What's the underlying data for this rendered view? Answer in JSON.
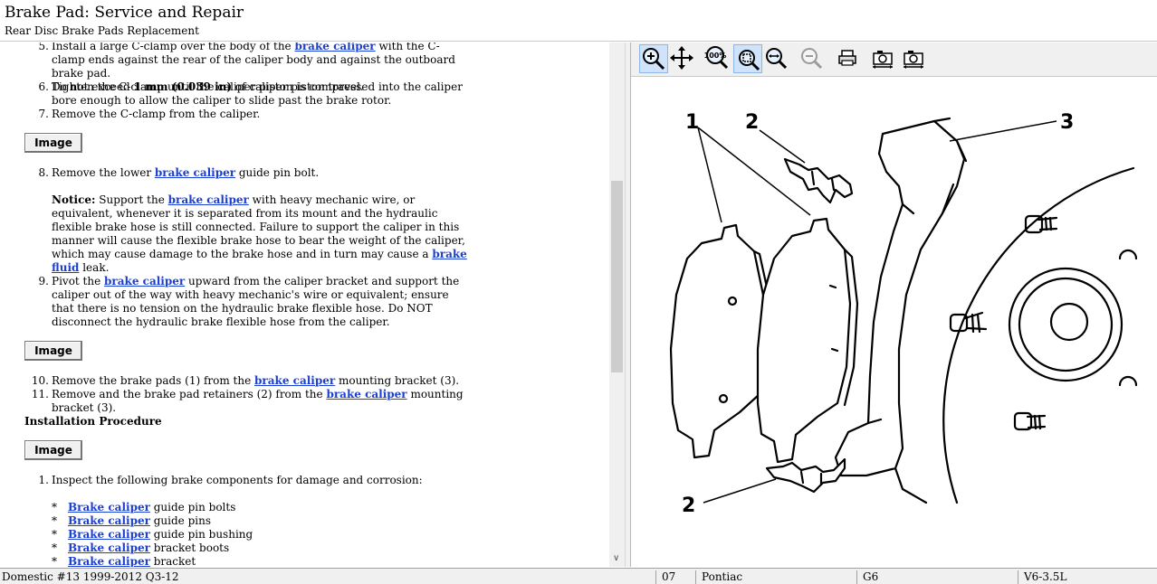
{
  "header": {
    "title": "Brake Pad:  Service and Repair",
    "subtitle": "Rear Disc Brake Pads Replacement"
  },
  "content": {
    "step5": {
      "num": "5.",
      "pre": "Install a large C-clamp over the body of the ",
      "link": "brake caliper",
      "post": " with the C-clamp ends against the rear of the caliper body and against the outboard brake pad.",
      "limit_pre": "Do not exceed ",
      "limit_bold": "1 mm (0.039 in)",
      "limit_post": " of caliper piston travel."
    },
    "step6": {
      "num": "6.",
      "text": "Tighten the C-clamp until the caliper piston is compressed into the caliper bore enough to allow the caliper to slide past the brake rotor."
    },
    "step7": {
      "num": "7.",
      "text": "Remove the C-clamp from the caliper."
    },
    "image_label": "Image",
    "step8": {
      "num": "8.",
      "pre": "Remove the lower ",
      "link": "brake caliper",
      "post": " guide pin bolt."
    },
    "notice": {
      "label": "Notice:",
      "pre": " Support the ",
      "link1": "brake caliper",
      "mid": " with heavy mechanic wire, or equivalent, whenever it is separated from its mount and the hydraulic flexible brake hose is still connected. Failure to support the caliper in this manner will cause the flexible brake hose to bear the weight of the caliper, which may cause damage to the brake hose and in turn may cause a ",
      "link2": "brake fluid",
      "post": " leak."
    },
    "step9": {
      "num": "9.",
      "pre": "Pivot the ",
      "link": "brake caliper",
      "post": " upward from the caliper bracket and support the caliper out of the way with heavy mechanic's wire or equivalent; ensure that there is no tension on the hydraulic brake flexible hose. Do NOT disconnect the hydraulic brake flexible hose from the caliper."
    },
    "step10": {
      "num": "10.",
      "pre": "Remove the brake pads (1) from the ",
      "link": "brake caliper",
      "post": " mounting bracket (3)."
    },
    "step11": {
      "num": "11.",
      "pre": "Remove and the brake pad retainers (2) from the ",
      "link": "brake caliper",
      "post": " mounting bracket (3)."
    },
    "installation_heading": "Installation Procedure",
    "inst1": {
      "num": "1.",
      "text": "Inspect the following brake components for damage and corrosion:"
    },
    "bullets": [
      {
        "mark": "*",
        "link": "Brake caliper",
        "text": " guide pin bolts"
      },
      {
        "mark": "*",
        "link": "Brake caliper",
        "text": " guide pins"
      },
      {
        "mark": "*",
        "link": "Brake caliper",
        "text": " guide pin bushing"
      },
      {
        "mark": "*",
        "link": "Brake caliper",
        "text": " bracket boots"
      },
      {
        "mark": "*",
        "link": "Brake caliper",
        "text": " bracket"
      }
    ]
  },
  "toolbar": {
    "buttons": [
      {
        "name": "zoom-in",
        "icon": "zoom-in-icon",
        "active": true
      },
      {
        "name": "pan",
        "icon": "pan-icon",
        "active": false
      },
      {
        "name": "zoom-100",
        "icon": "zoom-100-icon",
        "label": "100%",
        "active": false
      },
      {
        "name": "zoom-fit",
        "icon": "zoom-fit-icon",
        "active": true
      },
      {
        "name": "zoom-width",
        "icon": "zoom-width-icon",
        "active": false
      },
      {
        "name": "zoom-out",
        "icon": "zoom-out-icon",
        "active": false
      },
      {
        "name": "print",
        "icon": "printer-icon",
        "active": false
      },
      {
        "name": "copy-image",
        "icon": "camera-icon",
        "active": false
      },
      {
        "name": "save-image",
        "icon": "camera-icon",
        "active": false
      }
    ]
  },
  "diagram": {
    "callouts": [
      "1",
      "2",
      "3",
      "2"
    ]
  },
  "statusbar": {
    "database": "Domestic #13 1999-2012 Q3-12",
    "year": "07",
    "make": "Pontiac",
    "model": "G6",
    "engine": "V6-3.5L"
  },
  "colors": {
    "link": "#1b3fd3",
    "toolbar_active": "#cfe3fb"
  }
}
